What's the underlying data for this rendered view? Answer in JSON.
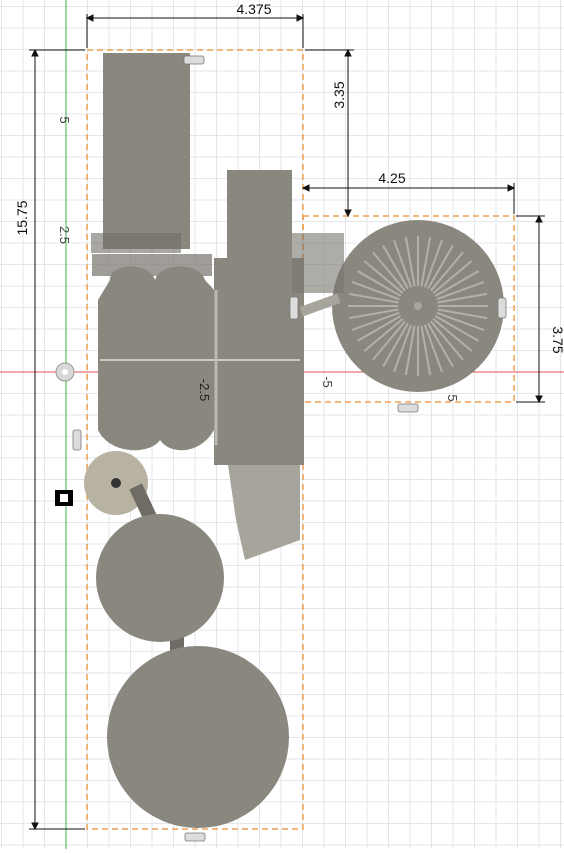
{
  "dimensions": {
    "top_width": "4.375",
    "right_gap_vertical": "3.35",
    "right_width": "4.25",
    "right_height": "3.75",
    "total_height": "15.75"
  },
  "axis_labels": {
    "y_5": "5",
    "y_2_5": "2.5",
    "x_neg_2_5": "-2.5",
    "x_neg_5": "-5",
    "y_neg_5": "5"
  },
  "colors": {
    "background": "#ffffff",
    "grid": "#e3e6ea",
    "x_axis": "#e05050",
    "y_axis": "#3cb44b",
    "model_fill": "#8a877f",
    "model_dark": "#6f6c65",
    "boundary_dash": "#f0a050",
    "dimension_line": "#111111"
  },
  "icons": [
    "sketch-point-icon",
    "origin-icon",
    "constraint-marker-icon"
  ]
}
